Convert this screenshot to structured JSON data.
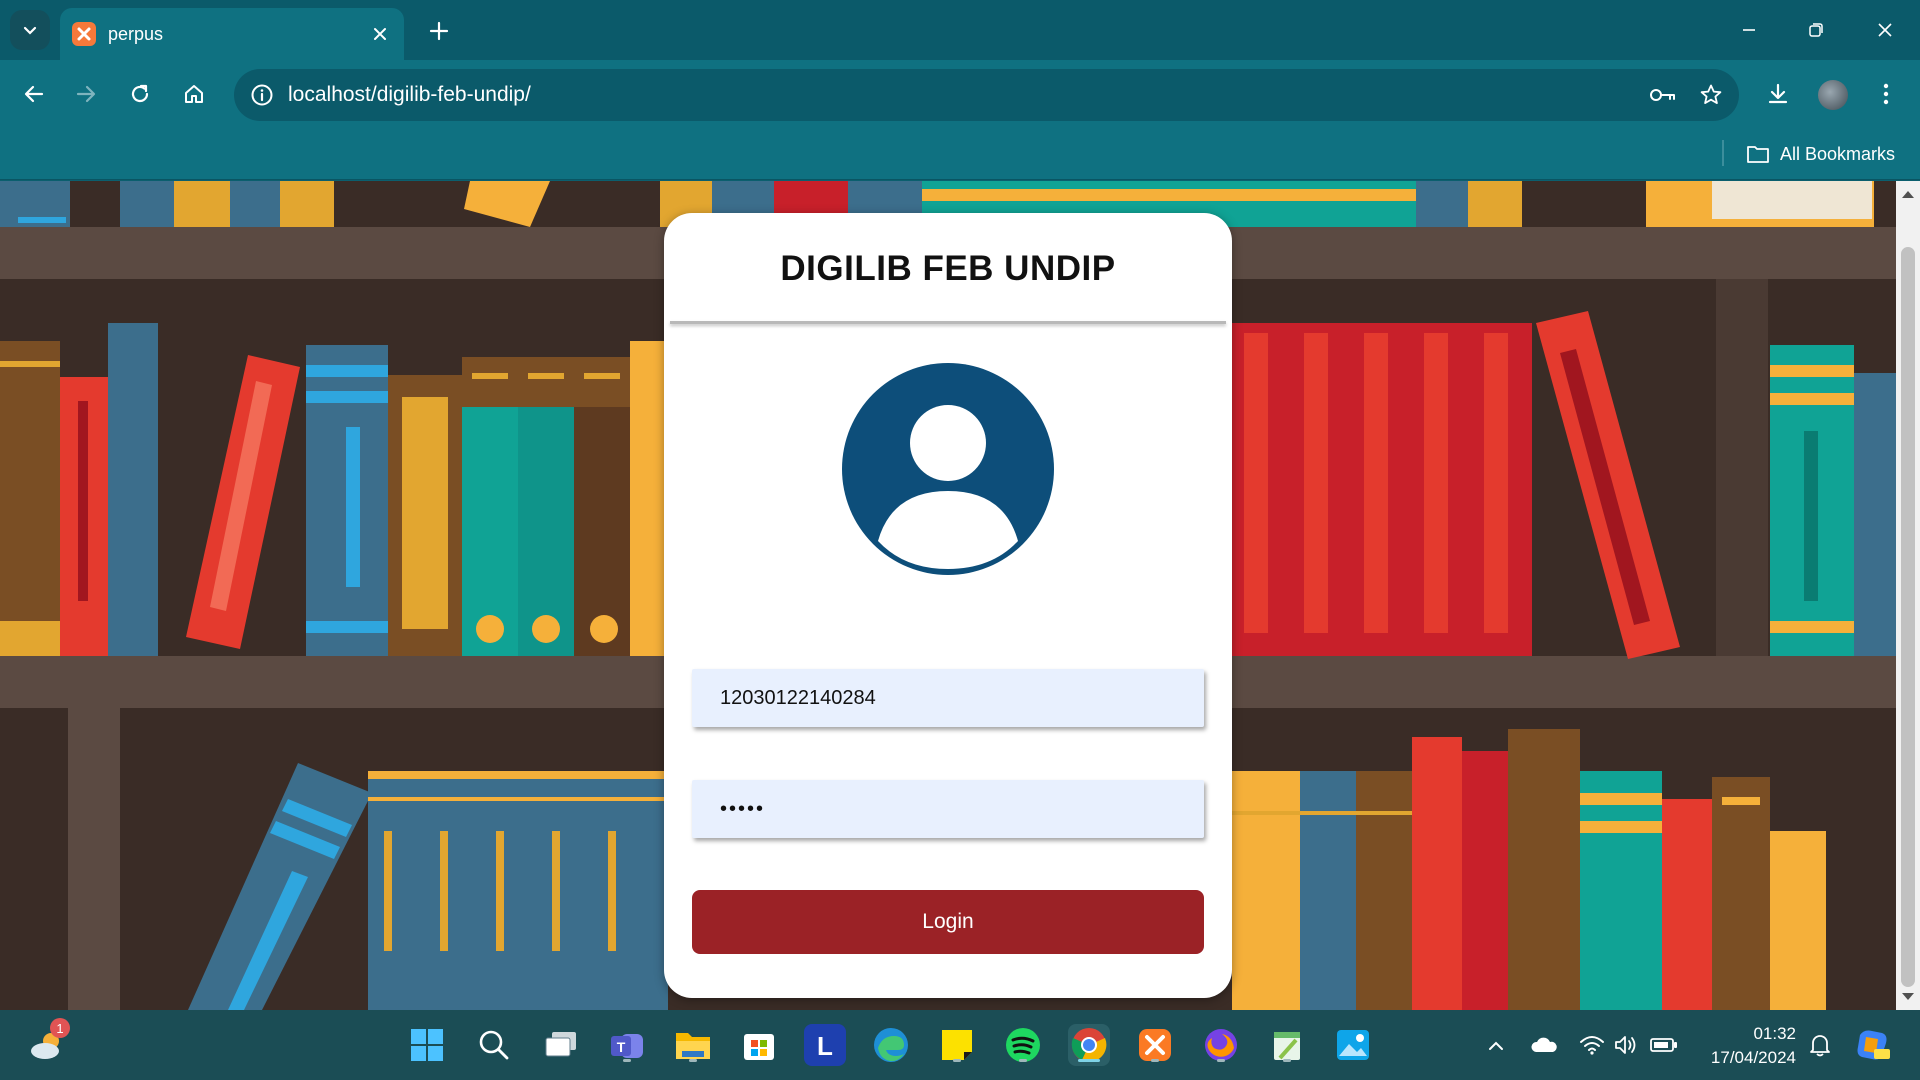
{
  "browser": {
    "tab": {
      "title": "perpus"
    },
    "url": "localhost/digilib-feb-undip/",
    "bookmarks": {
      "all_label": "All Bookmarks"
    }
  },
  "page": {
    "title": "DIGILIB FEB UNDIP",
    "username_value": "12030122140284",
    "password_mask": "•••••",
    "login_label": "Login",
    "colors": {
      "login_button": "#9b2226",
      "avatar": "#0d4e7a",
      "input_bg": "#e8f0fe"
    }
  },
  "taskbar": {
    "weather_badge": "1",
    "clock": {
      "time": "01:32",
      "date": "17/04/2024"
    },
    "apps": [
      "start-icon",
      "search-icon",
      "task-view-icon",
      "teams-icon",
      "file-explorer-icon",
      "store-icon",
      "l-app-icon",
      "edge-icon",
      "sticky-notes-icon",
      "spotify-icon",
      "chrome-icon",
      "xampp-icon",
      "firefox-icon",
      "notepad-icon",
      "photos-icon"
    ]
  }
}
